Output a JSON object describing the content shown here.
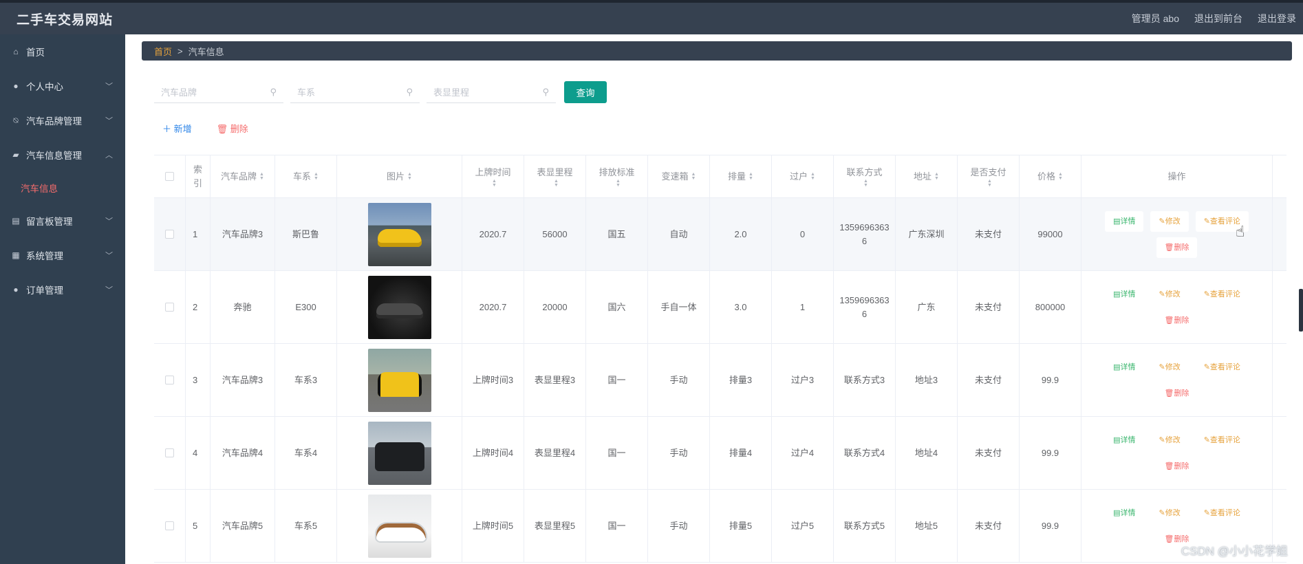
{
  "app": {
    "title": "二手车交易网站"
  },
  "header": {
    "user": "管理员 abo",
    "to_front": "退出到前台",
    "logout": "退出登录"
  },
  "sidebar": {
    "items": [
      {
        "label": "首页",
        "icon": "home-icon",
        "chevron": ""
      },
      {
        "label": "个人中心",
        "icon": "user-icon",
        "chevron": "﹀"
      },
      {
        "label": "汽车品牌管理",
        "icon": "bell-slash-icon",
        "chevron": "﹀"
      },
      {
        "label": "汽车信息管理",
        "icon": "briefcase-icon",
        "chevron": "︿"
      },
      {
        "label": "留言板管理",
        "icon": "chart-icon",
        "chevron": "﹀"
      },
      {
        "label": "系统管理",
        "icon": "grid-icon",
        "chevron": "﹀"
      },
      {
        "label": "订单管理",
        "icon": "user-icon",
        "chevron": "﹀"
      }
    ],
    "sub_item": "汽车信息"
  },
  "breadcrumb": {
    "home": "首页",
    "separator": ">",
    "current": "汽车信息"
  },
  "search": {
    "brand_placeholder": "汽车品牌",
    "series_placeholder": "车系",
    "mileage_placeholder": "表显里程",
    "query_label": "查询"
  },
  "actions": {
    "add": "＋ 新增",
    "delete": "删除"
  },
  "table": {
    "headers": {
      "index": "索引",
      "brand": "汽车品牌",
      "series": "车系",
      "image": "图片",
      "listing_time": "上牌时间",
      "mileage": "表显里程",
      "emission": "排放标准",
      "gearbox": "变速箱",
      "displacement": "排量",
      "transfer": "过户",
      "contact": "联系方式",
      "address": "地址",
      "paid": "是否支付",
      "price": "价格",
      "operation": "操作"
    },
    "ops": {
      "detail": "详情",
      "edit": "修改",
      "review": "查看评论",
      "delete": "删除"
    },
    "rows": [
      {
        "index": "1",
        "brand": "汽车品牌3",
        "series": "斯巴鲁",
        "listing_time": "2020.7",
        "mileage": "56000",
        "emission": "国五",
        "gearbox": "自动",
        "displacement": "2.0",
        "transfer": "0",
        "contact": "13596963636",
        "address": "广东深圳",
        "paid": "未支付",
        "price": "99000"
      },
      {
        "index": "2",
        "brand": "奔驰",
        "series": "E300",
        "listing_time": "2020.7",
        "mileage": "20000",
        "emission": "国六",
        "gearbox": "手自一体",
        "displacement": "3.0",
        "transfer": "1",
        "contact": "13596963636",
        "address": "广东",
        "paid": "未支付",
        "price": "800000"
      },
      {
        "index": "3",
        "brand": "汽车品牌3",
        "series": "车系3",
        "listing_time": "上牌时间3",
        "mileage": "表显里程3",
        "emission": "国一",
        "gearbox": "手动",
        "displacement": "排量3",
        "transfer": "过户3",
        "contact": "联系方式3",
        "address": "地址3",
        "paid": "未支付",
        "price": "99.9"
      },
      {
        "index": "4",
        "brand": "汽车品牌4",
        "series": "车系4",
        "listing_time": "上牌时间4",
        "mileage": "表显里程4",
        "emission": "国一",
        "gearbox": "手动",
        "displacement": "排量4",
        "transfer": "过户4",
        "contact": "联系方式4",
        "address": "地址4",
        "paid": "未支付",
        "price": "99.9"
      },
      {
        "index": "5",
        "brand": "汽车品牌5",
        "series": "车系5",
        "listing_time": "上牌时间5",
        "mileage": "表显里程5",
        "emission": "国一",
        "gearbox": "手动",
        "displacement": "排量5",
        "transfer": "过户5",
        "contact": "联系方式5",
        "address": "地址5",
        "paid": "未支付",
        "price": "99.9"
      }
    ]
  },
  "watermark": "CSDN @小小花学姐"
}
